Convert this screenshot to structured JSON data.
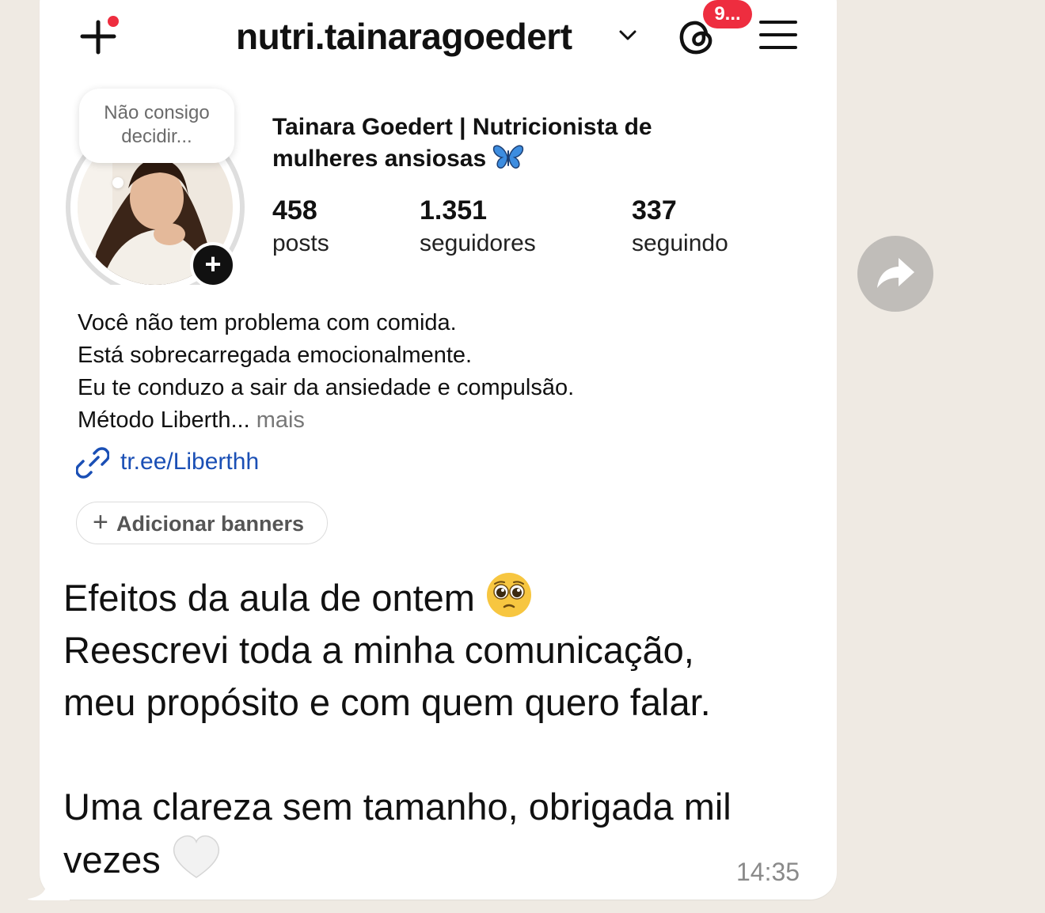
{
  "header": {
    "username": "nutri.tainaragoedert",
    "notification_badge": "9..."
  },
  "profile": {
    "note_text": "Não consigo decidir...",
    "display_name": "Tainara Goedert | Nutricionista de mulheres ansiosas",
    "stats": {
      "posts_count": "458",
      "posts_label": "posts",
      "followers_count": "1.351",
      "followers_label": "seguidores",
      "following_count": "337",
      "following_label": "seguindo"
    },
    "bio": {
      "line1": "Você não tem problema com comida.",
      "line2": "Está sobrecarregada emocionalmente.",
      "line3": "Eu te conduzo a sair da ansiedade e compulsão.",
      "line4": "Método Liberth...",
      "more": "mais"
    },
    "link": "tr.ee/Liberthh",
    "add_banners_label": "Adicionar banners"
  },
  "message": {
    "line1": "Efeitos da aula de ontem",
    "line2": "Reescrevi toda a minha comunicação,",
    "line3": "meu propósito e com quem quero falar.",
    "line4": "Uma clareza sem tamanho, obrigada mil",
    "line5": "vezes",
    "time": "14:35"
  },
  "colors": {
    "chat_background": "#efeae3",
    "bubble": "#ffffff",
    "badge": "#ee2d3f",
    "link": "#1a4fb5"
  },
  "icons": {
    "create": "plus-icon",
    "dropdown": "chevron-down-icon",
    "threads": "threads-icon",
    "menu": "hamburger-menu-icon",
    "link": "link-icon",
    "forward": "forward-arrow-icon",
    "butterfly": "butterfly-emoji",
    "pleading": "pleading-face-emoji",
    "heart": "white-heart-emoji"
  }
}
